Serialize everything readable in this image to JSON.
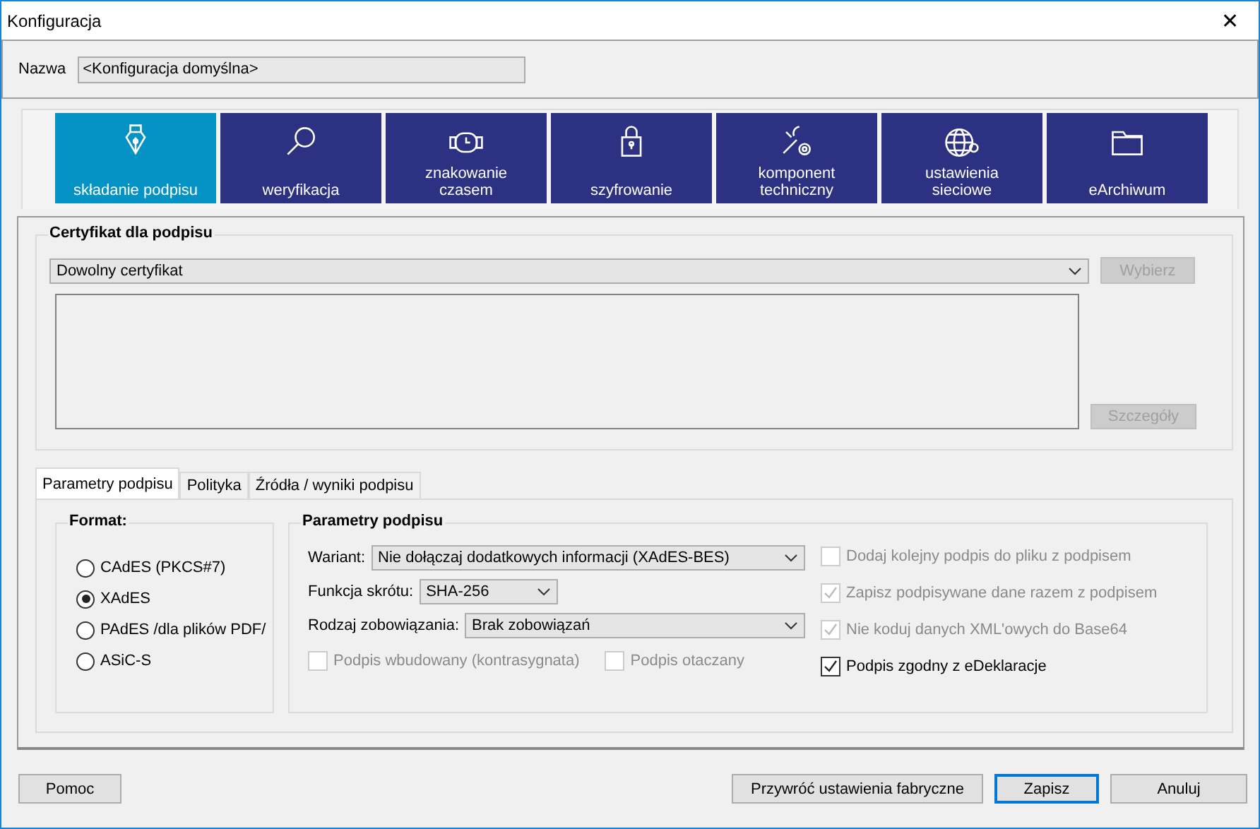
{
  "window": {
    "title": "Konfiguracja",
    "close": "✕"
  },
  "name_field": {
    "label": "Nazwa",
    "value": "<Konfiguracja domyślna>"
  },
  "tiles": [
    {
      "label": "składanie podpisu",
      "kind": "pen",
      "selected": true
    },
    {
      "label": "weryfikacja",
      "kind": "magnifier",
      "selected": false
    },
    {
      "label": "znakowanie czasem",
      "kind": "watch",
      "selected": false
    },
    {
      "label": "szyfrowanie",
      "kind": "lock",
      "selected": false
    },
    {
      "label": "komponent techniczny",
      "kind": "tools",
      "selected": false
    },
    {
      "label": "ustawienia sieciowe",
      "kind": "globe",
      "selected": false
    },
    {
      "label": "eArchiwum",
      "kind": "folder",
      "selected": false
    }
  ],
  "certificate": {
    "title": "Certyfikat dla podpisu",
    "combo": "Dowolny certyfikat",
    "choose_button": {
      "label": "Wybierz",
      "disabled": true
    },
    "details_button": {
      "label": "Szczegóły",
      "disabled": true
    }
  },
  "tabs": [
    {
      "label": "Parametry podpisu",
      "selected": true
    },
    {
      "label": "Polityka",
      "selected": false
    },
    {
      "label": "Źródła / wyniki podpisu",
      "selected": false
    }
  ],
  "format": {
    "title": "Format:",
    "options": [
      {
        "label": "CAdES (PKCS#7)",
        "selected": false
      },
      {
        "label": "XAdES",
        "selected": true
      },
      {
        "label": "PAdES /dla plików PDF/",
        "selected": false
      },
      {
        "label": "ASiC-S",
        "selected": false
      }
    ]
  },
  "parameters": {
    "title": "Parametry podpisu",
    "fields": [
      {
        "label": "Wariant:",
        "value": "Nie dołączaj dodatkowych informacji (XAdES-BES)",
        "kind": "wide"
      },
      {
        "label": "Funkcja skrótu:",
        "value": "SHA-256",
        "kind": "short"
      },
      {
        "label": "Rodzaj zobowiązania:",
        "value": "Brak zobowiązań",
        "kind": "wide"
      }
    ],
    "bottom_checks": [
      {
        "label": "Podpis wbudowany (kontrasygnata)",
        "checked": false,
        "disabled": true
      },
      {
        "label": "Podpis otaczany",
        "checked": false,
        "disabled": true
      }
    ],
    "side_checks": [
      {
        "label": "Dodaj kolejny podpis do pliku z podpisem",
        "checked": false,
        "disabled": true
      },
      {
        "label": "Zapisz podpisywane dane razem z podpisem",
        "checked": true,
        "disabled": true
      },
      {
        "label": "Nie koduj danych XML'owych do Base64",
        "checked": true,
        "disabled": true
      },
      {
        "label": "Podpis zgodny z eDeklaracje",
        "checked": true,
        "disabled": false
      }
    ]
  },
  "buttons": {
    "help": {
      "label": "Pomoc"
    },
    "actions": [
      {
        "label": "Przywróć ustawienia fabryczne",
        "default": false
      },
      {
        "label": "Zapisz",
        "default": true
      },
      {
        "label": "Anuluj",
        "default": false
      }
    ]
  }
}
